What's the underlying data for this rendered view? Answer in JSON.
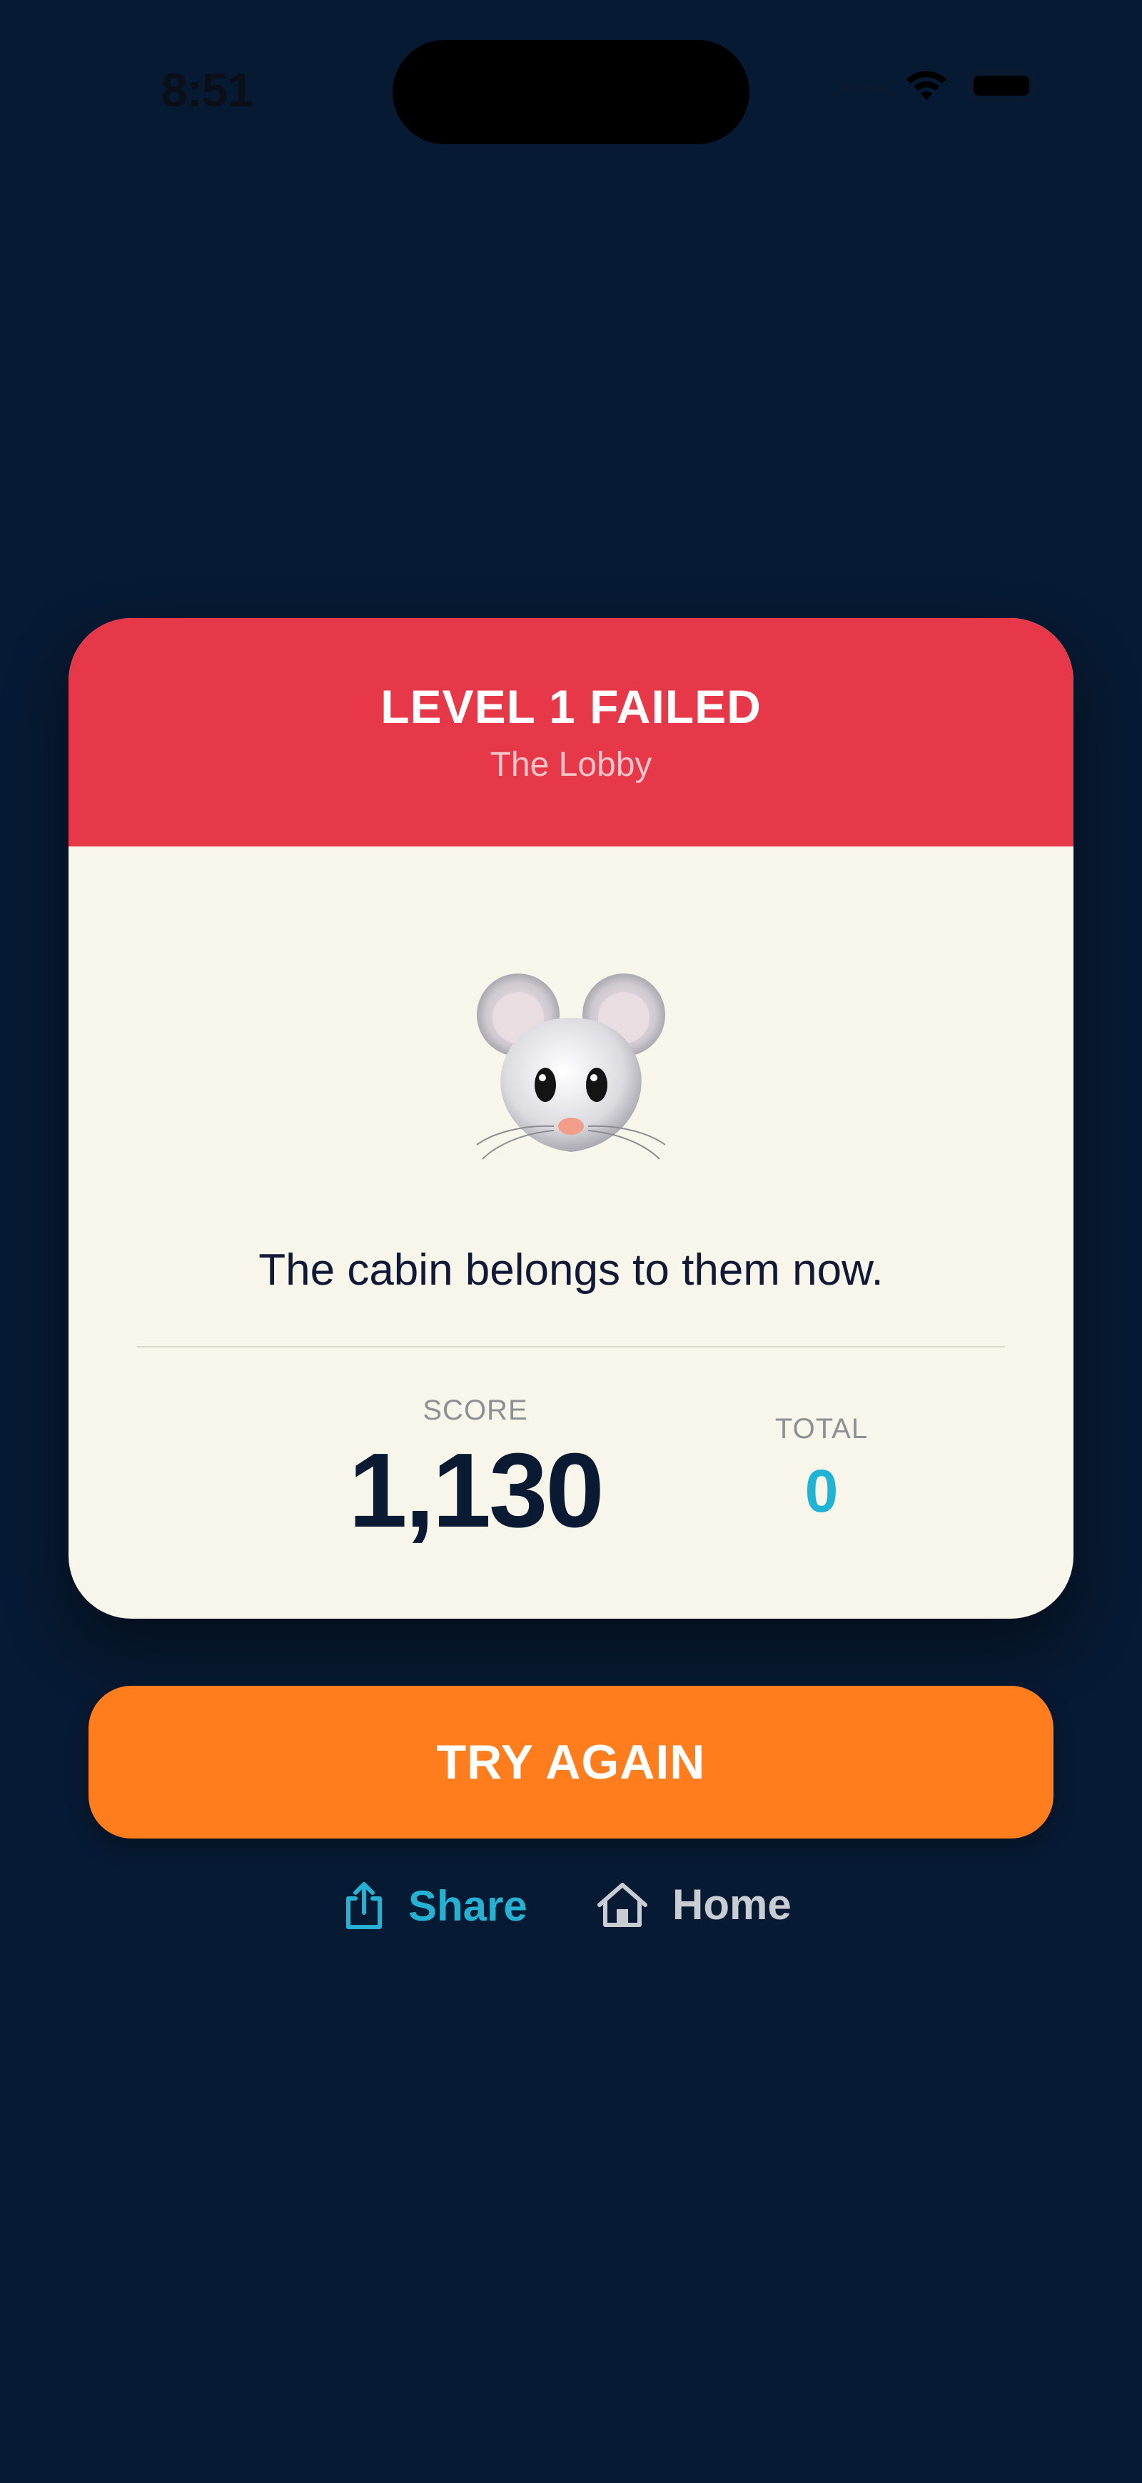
{
  "status_bar": {
    "time": "8:51"
  },
  "result_card": {
    "title": "LEVEL 1 FAILED",
    "subtitle": "The Lobby",
    "icon": "mouse-face-icon",
    "message": "The cabin belongs to them now.",
    "score": {
      "label": "SCORE",
      "value": "1,130"
    },
    "total": {
      "label": "TOTAL",
      "value": "0"
    }
  },
  "actions": {
    "try_again_label": "TRY AGAIN",
    "share_label": "Share",
    "share_icon": "share-icon",
    "home_label": "Home",
    "home_icon": "home-icon"
  },
  "colors": {
    "background": "#071a33",
    "header_red": "#e63849",
    "card_cream": "#f8f5ea",
    "button_orange": "#ff7d1c",
    "accent_cyan": "#21b3d3"
  }
}
